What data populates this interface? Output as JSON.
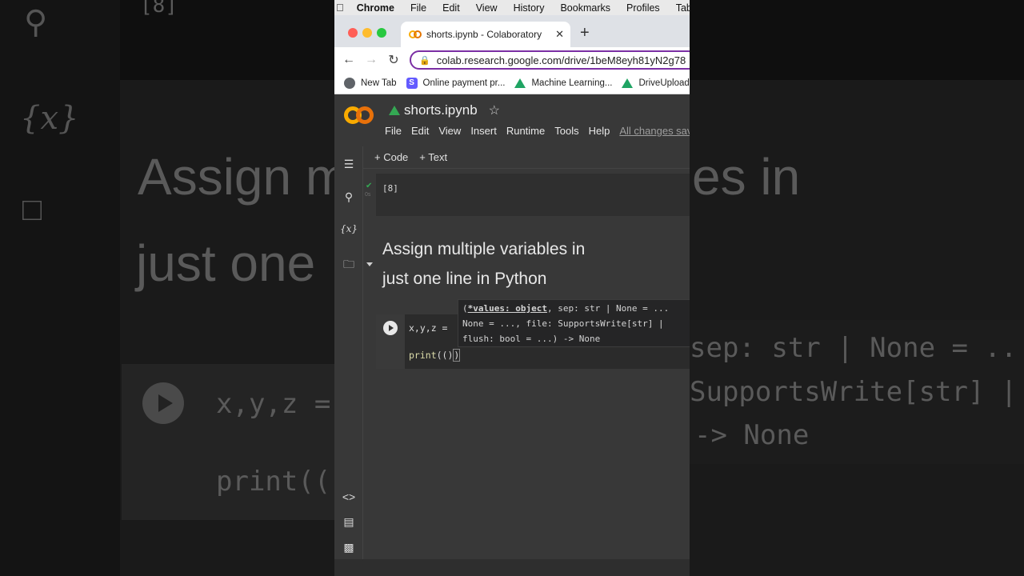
{
  "mac_menu": {
    "app": "Chrome",
    "items": [
      "File",
      "Edit",
      "View",
      "History",
      "Bookmarks",
      "Profiles",
      "Tab"
    ]
  },
  "browser": {
    "tab_title": "shorts.ipynb - Colaboratory",
    "url": "colab.research.google.com/drive/1beM8eyh81yN2g78",
    "bookmarks": [
      "New Tab",
      "Online payment pr...",
      "Machine Learning...",
      "DriveUpload"
    ]
  },
  "colab": {
    "notebook_title": "shorts.ipynb",
    "menu": [
      "File",
      "Edit",
      "View",
      "Insert",
      "Runtime",
      "Tools",
      "Help"
    ],
    "save_status": "All changes saved",
    "add_code": "+ Code",
    "add_text": "+ Text",
    "exec_count": "[8]",
    "exec_time": "0s",
    "markdown_line1": "Assign multiple variables in",
    "markdown_line2": "just one line in Python",
    "code_line1": "x,y,z = ",
    "code_line2_fn": "print",
    "code_line2_args": "(()",
    "code_line2_close": ")",
    "tooltip_sig_bold": "*values: object",
    "tooltip_line1_rest": ", sep: str | None = ...",
    "tooltip_line2": "None = ..., file: SupportsWrite[str] |",
    "tooltip_line3": "flush: bool = ...) -> None"
  },
  "background": {
    "heading_line1_left": "Assign m",
    "heading_line1_right": "es in",
    "heading_line2": "just one",
    "code_left1": "x,y,z =",
    "code_left2": "print((",
    "tip_right1": "sep: str | None = ..",
    "tip_right2": "SupportsWrite[str] |",
    "tip_right3": "-> None",
    "exec_label": "[8]"
  },
  "colors": {
    "accent_omnibox": "#7b2fa4",
    "colab_orange": "#f9ab00",
    "run_check": "#34a853"
  }
}
